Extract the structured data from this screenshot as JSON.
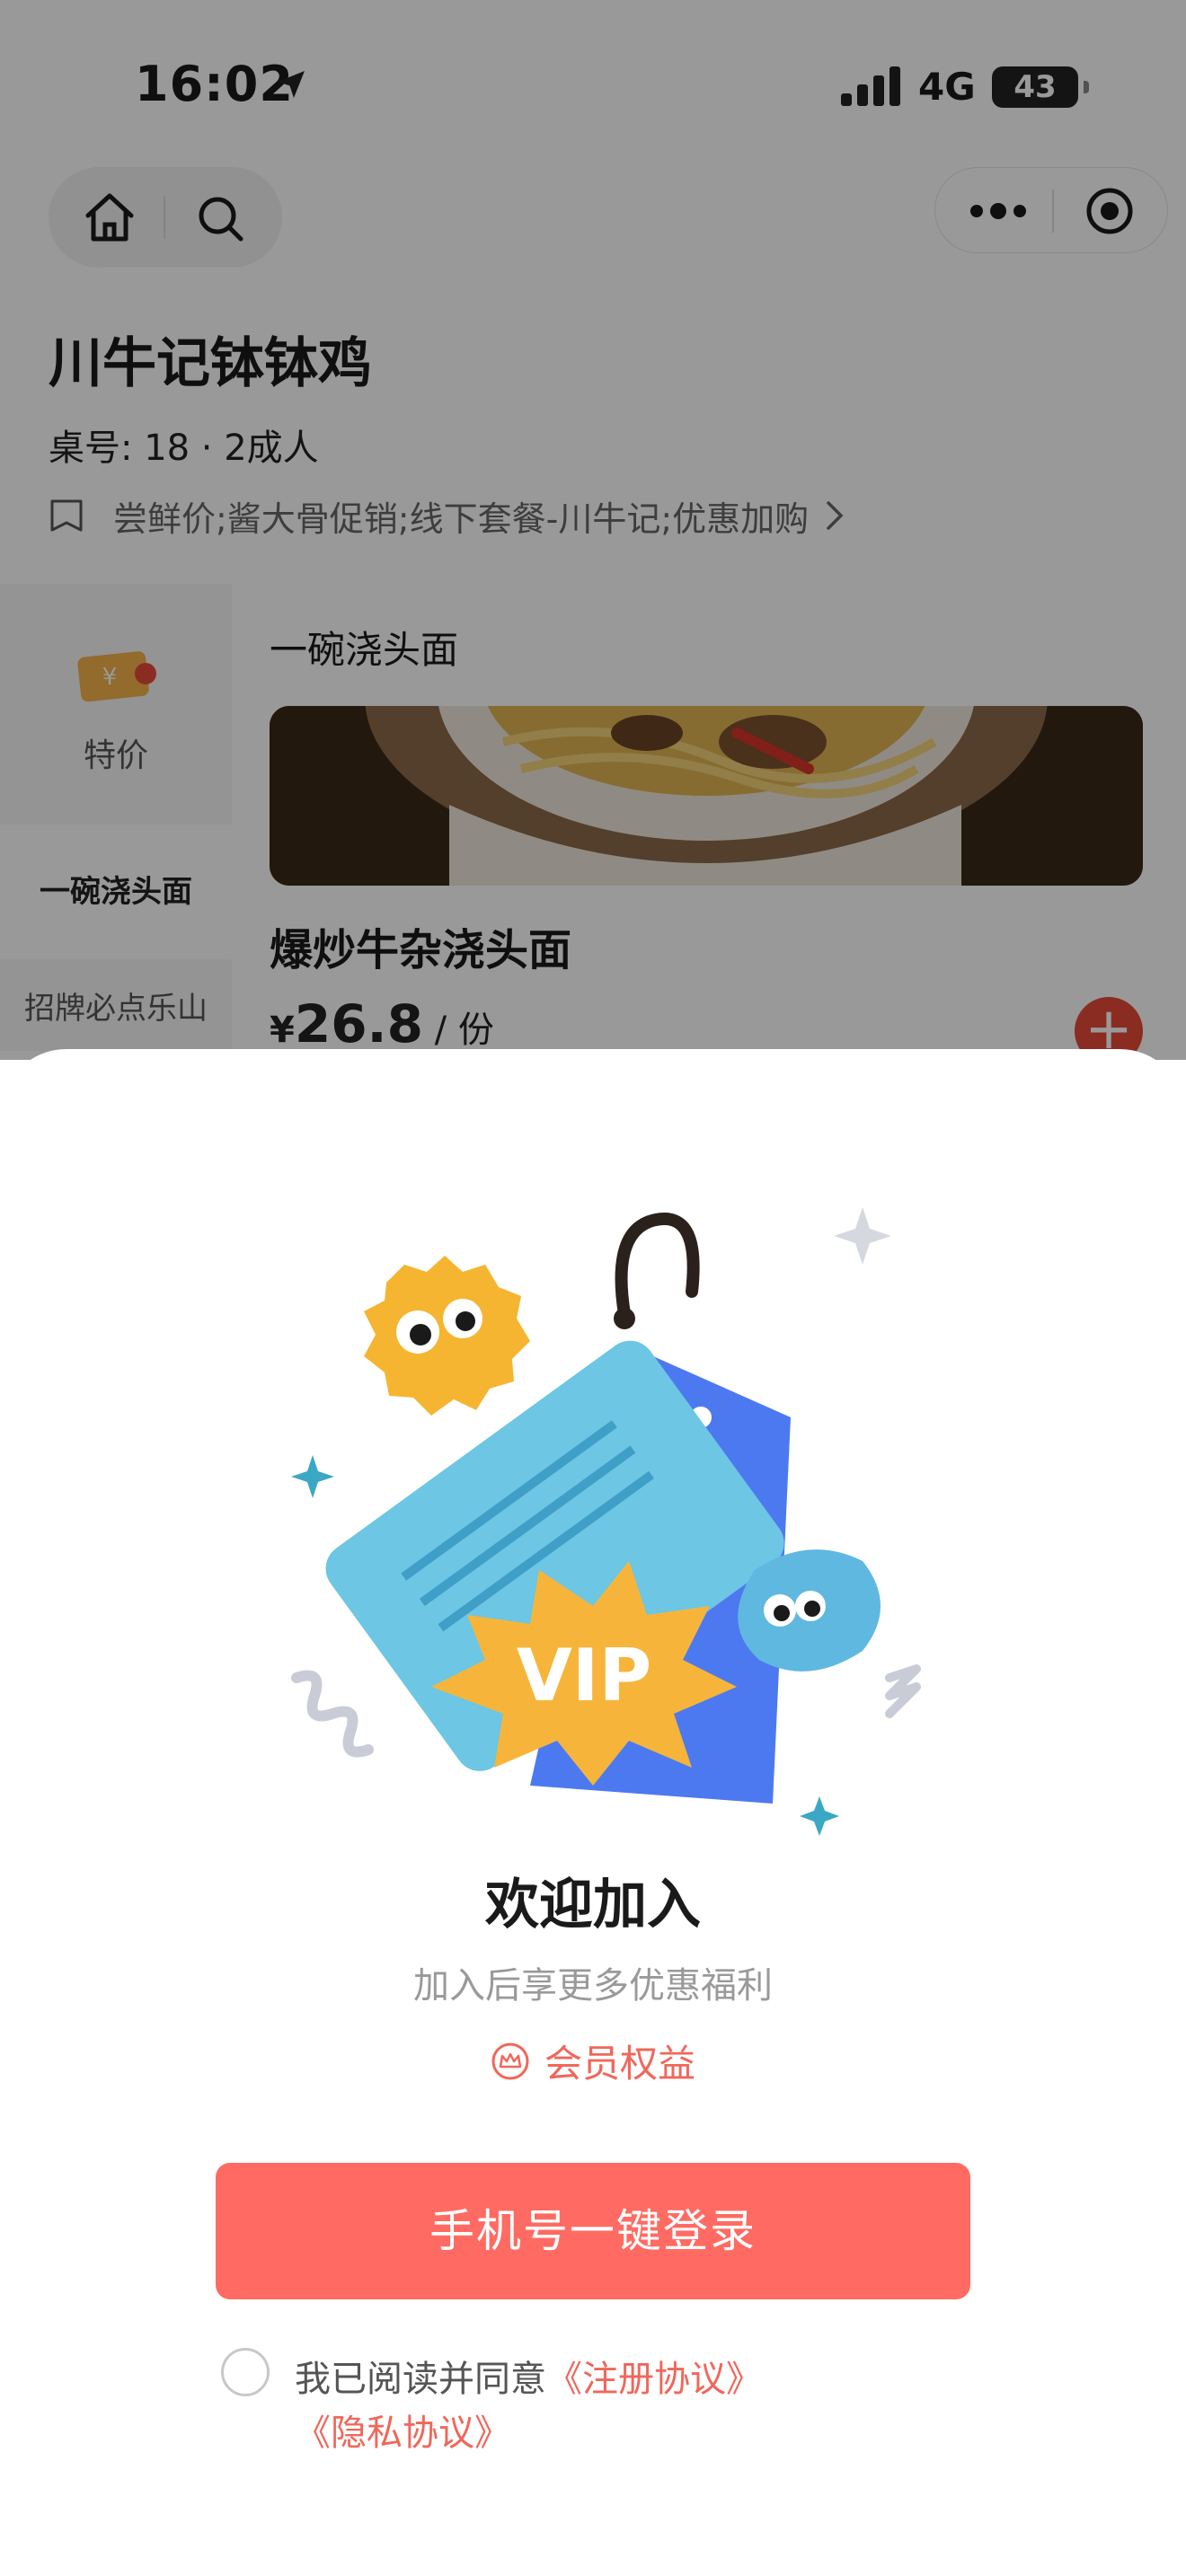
{
  "status_bar": {
    "time": "16:02",
    "network": "4G",
    "battery": "43"
  },
  "header": {
    "store_name": "川牛记钵钵鸡",
    "table_info": "桌号: 18 · 2成人",
    "promo_text": "尝鲜价;酱大骨促销;线下套餐-川牛记;优惠加购"
  },
  "sidebar": {
    "items": [
      {
        "label": "特价"
      },
      {
        "label": "一碗浇头面"
      },
      {
        "label": "招牌必点乐山"
      }
    ]
  },
  "menu": {
    "section_title": "一碗浇头面",
    "dish": {
      "name": "爆炒牛杂浇头面",
      "currency": "¥",
      "price": "26.8",
      "unit": " / 份"
    },
    "add_symbol": "+"
  },
  "login_sheet": {
    "illustration_text": "VIP",
    "title": "欢迎加入",
    "subtitle": "加入后享更多优惠福利",
    "benefit_label": "会员权益",
    "login_button": "手机号一键登录",
    "agreement_prefix": "我已阅读并同意",
    "register_link": "《注册协议》",
    "privacy_link": "《隐私协议》"
  },
  "colors": {
    "accent": "#ff6b62",
    "link": "#f0675a",
    "add_button": "#e84a3b"
  }
}
